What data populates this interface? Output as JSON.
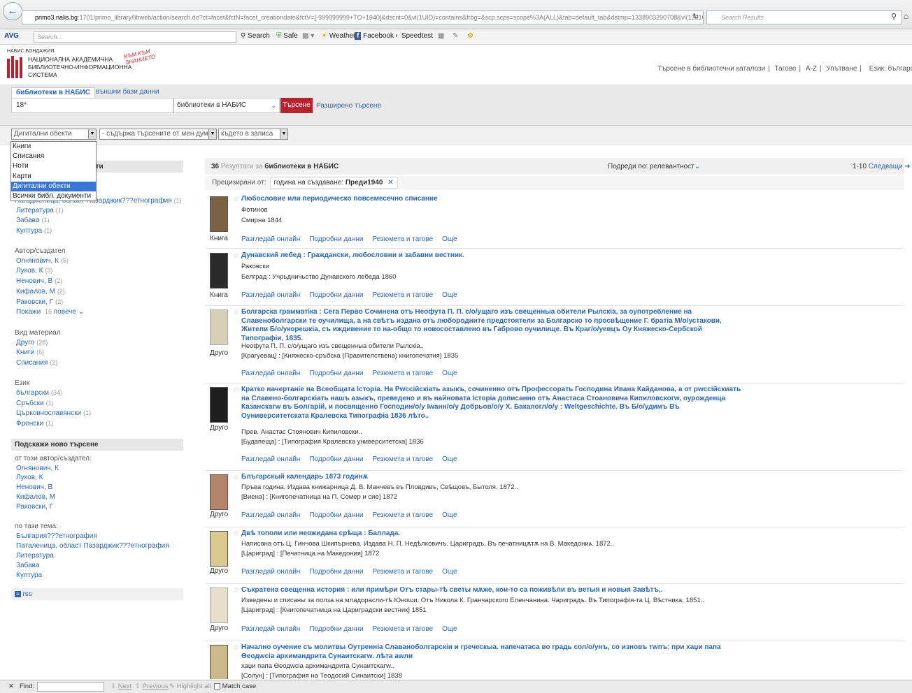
{
  "browser": {
    "url_host": "primo3.nalis.bg",
    "url_rest": ":1701/primo_library/libweb/action/search.do?ct=facet&fctN=facet_creationdate&fctV=[-999999999+TO+1940]&dscnt=0&vl(1UID)=contains&frbg=&scp.scps=scope%3A(ALL)&tab=default_tab&dstmp=1338903290708&vl(12610805UI1)=",
    "search_placeholder": "Search Results"
  },
  "avg": {
    "logo": "AVG",
    "search_placeholder": "Search...",
    "search_label": "Search",
    "safe_label": "Safe",
    "weather_label": "Weather",
    "facebook_label": "Facebook",
    "speedtest_label": "Speedtest"
  },
  "header": {
    "logo_top": "БОНДАЖИЯ",
    "logo_abbr": "НАБИС",
    "logo_line1": "НАЦИОНАЛНА АКАДЕМИЧНА",
    "logo_line2": "БИБЛИОТЕЧНО-ИНФОРМАЦИОННА",
    "logo_line3": "СИСТЕМА",
    "slogan": "КЪМ КЪМ ЗНАНИЕТО",
    "nav_catalog": "Търсене в библиотечни каталози",
    "nav_tags": "Тагове",
    "nav_az": "A-Z",
    "nav_guide": "Упътване",
    "nav_lang": "Език: български"
  },
  "search": {
    "tab_active": "библиотеки в НАБИС",
    "tab_external": "външни бази данни",
    "query": "18*",
    "scope": "библиотеки в НАБИС",
    "go_label": "Търсене",
    "advanced_label": "Разширено търсене"
  },
  "filters": {
    "type_selected": "Дигитални обекти",
    "contains": "- съдържа търсените от мен думи",
    "where": "където в записа"
  },
  "dropdown": [
    "Книги",
    "Списания",
    "Ноти",
    "Карти",
    "Дигитални обекти",
    "Всички библ. документи"
  ],
  "left": {
    "hdr_partial": "ати",
    "partial_item": "Нагадженица, област Пазарджик???етнография",
    "partial_count": "(1)",
    "topic_items": [
      {
        "label": "Литература",
        "count": "(1)"
      },
      {
        "label": "Забава",
        "count": "(1)"
      },
      {
        "label": "Култура",
        "count": "(1)"
      }
    ],
    "author_heading": "Автор/създател",
    "authors": [
      {
        "label": "Огнянович, К",
        "count": "(5)"
      },
      {
        "label": "Луков, К",
        "count": "(3)"
      },
      {
        "label": "Ненович, В",
        "count": "(2)"
      },
      {
        "label": "Кифалов, М",
        "count": "(2)"
      },
      {
        "label": "Раковски, Г",
        "count": "(2)"
      }
    ],
    "show_more": "Покажи",
    "show_more_count": "15",
    "show_more_tail": "повече",
    "type_heading": "Вид материал",
    "types": [
      {
        "label": "Друго",
        "count": "(28)"
      },
      {
        "label": "Книги",
        "count": "(6)"
      },
      {
        "label": "Списания",
        "count": "(2)"
      }
    ],
    "lang_heading": "Език",
    "langs": [
      {
        "label": "български",
        "count": "(34)"
      },
      {
        "label": "Сръбски",
        "count": "(1)"
      },
      {
        "label": "Църковнославянски",
        "count": "(1)"
      },
      {
        "label": "Френски",
        "count": "(1)"
      }
    ],
    "suggest_heading": "Подскажи ново търсене",
    "by_author_heading": "от този автор/създател:",
    "suggest_authors": [
      "Огнянович, К",
      "Луков, К",
      "Ненович, В",
      "Кифалов, М",
      "Раковски, Г"
    ],
    "by_topic_heading": "по тази тема:",
    "suggest_topics": [
      "България???етнография",
      "Паталеница, област Пазарджик???етнография",
      "Литература",
      "Забава",
      "Култура"
    ],
    "rss": "rss"
  },
  "results": {
    "count": "36",
    "count_label": "Резултати за",
    "scope": "библиотеки в НАБИС",
    "sort_label": "Подреди по:",
    "sort_value": "релевантност",
    "paging": "1-10",
    "next": "Следващи",
    "refined_label": "Прецизирани от:",
    "refined_chip": "година на създаване:",
    "refined_value": "Преди1940",
    "link_view": "Разгледай онлайн",
    "link_details": "Подробни данни",
    "link_reviews": "Резюмета и тагове",
    "link_more": "Още",
    "items": [
      {
        "type": "Книга",
        "title": "Любословие или периодическо повсемесечно списание",
        "lines": [
          "Фотинов",
          "Смирна 1844"
        ]
      },
      {
        "type": "Книга",
        "title": "Дунавский лебед : Граждански, любословни и забавни вестник.",
        "lines": [
          "Раковски",
          "Белград : Учрьдничьство Дунавского лебеда 1860"
        ]
      },
      {
        "type": "Друго",
        "title": "Болгарска граммaтiка : Сега Перво Сочинена отъ Неофyта П. П. с/о/ущаго изъ свещенныа обители Рылскiа, за оупотребление на Славенoболгарски те оучилища, а на свѣтъ издана отъ любородните предстоятели за Болгарско то просвѣщение Г. братiа М/о/устакови, Жители Б/о/укорешкiа, съ иждивение то на-общо то новосоставлено въ Габрово оучилище. Въ Краг/о/уевцъ Оу Княжеско-Сербской Типографiи, 1835.",
        "lines": [
          "Неофyта П. П. с/о/ущаго изъ свещенныа обители Рылскiа..",
          "[Крагуевац] : [Княжеско-сръбска (Правителствена) книгопечатня] 1835"
        ]
      },
      {
        "type": "Друго",
        "title": "Кратко начертанiе на Всеобщата Iсторiа. На Рwссiйскiать азыкъ, сочиненно отъ Профессорать Господина Ивана Кайданова, а от рwссiйскиать на Славено-болгарскiать нашъ азыкъ, преведено и въ найновата Iсторiа дописанно отъ Анастаса Стоановича Кипиловскогw, оурожденца Казанскагw въ Болгарiй, и посвященно Господин/о/у Iwанн/о/у Добрьов/о/у Х. Бакалогл/о/у : Weltgeschichte. Въ Б/о/удимъ Въ Оуниверситетската Кралевска Типографiа 1836 лѣто..",
        "lines": [
          "Прев. Анастас Стоянович Кипиловски..",
          "[Будапеща] : [Типография Кралевска университетска] 1836"
        ]
      },
      {
        "type": "Друго",
        "title": "Блъгарскый календарь 1873 годинѫ",
        "lines": [
          "Пръва година. Издава книжарница Д. В. Манчевъ въ Пловдивъ, Свѣщовъ, Бытоля. 1872..",
          "[Виена] : [Книгопечатница на П. Сомер и сие] 1872"
        ]
      },
      {
        "type": "Друго",
        "title": "Двѣ тополи или неожидана срѣща : Баллада.",
        "lines": [
          "Написана отъ Ц. Гинчова Шкипърнева. Издава Н. П. Недѣлковичъ. Цариградъ. Въ печатницѫтѫ на В. Македониѧ. 1872..",
          "[Цариград] : [Печатница на Македония] 1872"
        ]
      },
      {
        "type": "Друго",
        "title": "Съкратена свещенна история : или примѣри Отъ стары-тѣ светы мѫже, кои-то са поживѣли въ ветыя и новыя Завѣтъ,.",
        "lines": [
          "Изведены и списаны за полза на младорасли-тѣ Юноши. Отъ Никола К. Гранчарского Еленчанина. Чариградъ. Въ Типографiя-та Ц. Вѣстника, 1851..",
          "[Цариград] : [Книгопечатница на Цариградски вестник] 1851"
        ]
      },
      {
        "type": "",
        "title": "Начално оучение съ молитвы Оутреннiа Славанoболгарскiи и греческыа. напечатаса во градь сол/о/унъ, со изновъ тwпъ: при хаџи папа Өеодwсiа архимандрита Сунаитскагw. лѣта аwли",
        "lines": [
          "хаџи папа Өеодwсiа архимандрита Сунаитскагw..",
          "[Солун] : [Типография на Теодосий Синаитски] 1838"
        ]
      }
    ]
  },
  "findbar": {
    "find_label": "Find:",
    "next_label": "Next",
    "prev_label": "Previous",
    "highlight_label": "Highlight all",
    "match_label": "Match case"
  },
  "colors": {
    "accent": "#2a67b1",
    "brand_red": "#b52230",
    "dropdown_selected": "#3875d7"
  }
}
